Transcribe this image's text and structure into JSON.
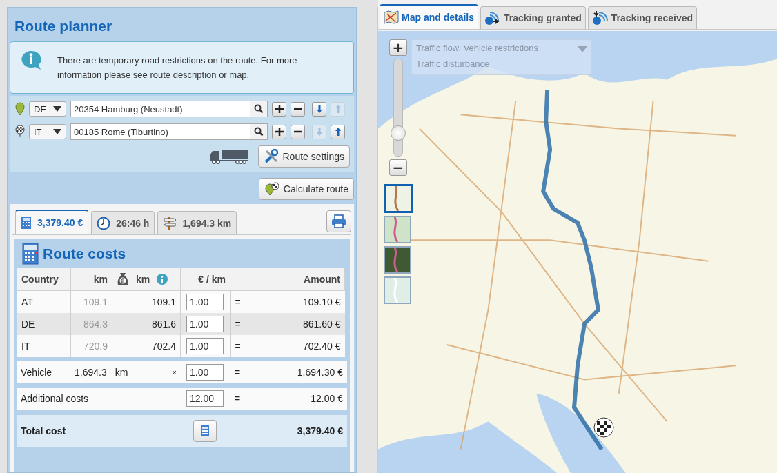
{
  "planner": {
    "title": "Route planner",
    "notice": "There are temporary road restrictions on the route. For more information please see route description or map.",
    "waypoints": [
      {
        "kind": "start",
        "country": "DE",
        "address": "20354 Hamburg (Neustadt)",
        "down_enabled": true,
        "up_enabled": false
      },
      {
        "kind": "finish",
        "country": "IT",
        "address": "00185 Rome (Tiburtino)",
        "down_enabled": false,
        "up_enabled": true
      }
    ],
    "route_settings": "Route settings",
    "calculate": "Calculate route"
  },
  "result_tabs": [
    {
      "kind": "cost",
      "label": "3,379.40 €",
      "selected": true
    },
    {
      "kind": "time",
      "label": "26:46 h",
      "selected": false
    },
    {
      "kind": "distance",
      "label": "1,694.3 km",
      "selected": false
    }
  ],
  "costs": {
    "title": "Route costs",
    "columns": [
      "Country",
      "km",
      "km",
      "€ / km",
      "Amount"
    ],
    "rows": [
      {
        "country": "AT",
        "km": "109.1",
        "toll_km": "109.1",
        "rate": "1.00",
        "eq": "=",
        "amount": "109.10 €",
        "highlighted": false
      },
      {
        "country": "DE",
        "km": "864.3",
        "toll_km": "861.6",
        "rate": "1.00",
        "eq": "=",
        "amount": "861.60 €",
        "highlighted": true
      },
      {
        "country": "IT",
        "km": "720.9",
        "toll_km": "702.4",
        "rate": "1.00",
        "eq": "=",
        "amount": "702.40 €",
        "highlighted": false
      }
    ],
    "vehicle": {
      "label": "Vehicle",
      "km": "1,694.3",
      "unit": "km",
      "times": "×",
      "rate": "1.00",
      "eq": "=",
      "amount": "1,694.30 €"
    },
    "additional": {
      "label": "Additional costs",
      "value": "12.00",
      "eq": "=",
      "amount": "12.00 €"
    },
    "total": {
      "label": "Total cost",
      "amount": "3,379.40 €"
    }
  },
  "map_tabs": [
    {
      "kind": "map",
      "label": "Map and details",
      "selected": true
    },
    {
      "kind": "granted",
      "label": "Tracking granted",
      "selected": false
    },
    {
      "kind": "received",
      "label": "Tracking received",
      "selected": false
    }
  ],
  "map": {
    "zoom_in": "+",
    "zoom_out": "−",
    "zoom": {
      "level": 0.2
    },
    "traffic_layers": [
      "Traffic flow,  Vehicle restrictions",
      "Traffic disturbance"
    ],
    "layers": [
      {
        "kind": "road",
        "selected": true
      },
      {
        "kind": "terrain",
        "selected": false
      },
      {
        "kind": "satellite",
        "selected": false
      },
      {
        "kind": "light",
        "selected": false
      }
    ]
  }
}
